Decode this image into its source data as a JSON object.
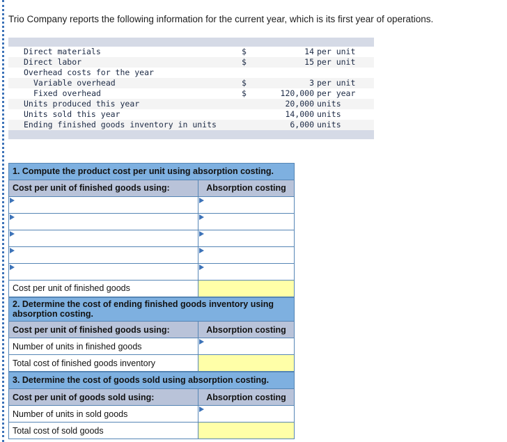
{
  "intro": {
    "text": "Trio Company reports the following information for the current year, which is its first year of operations."
  },
  "facts_table": {
    "rows": [
      {
        "label": "Direct materials",
        "currency": "$",
        "amount": "14",
        "unit": "per unit"
      },
      {
        "label": "Direct labor",
        "currency": "$",
        "amount": "15",
        "unit": "per unit"
      },
      {
        "label": "Overhead costs for the year",
        "currency": "",
        "amount": "",
        "unit": ""
      },
      {
        "label": "Variable overhead",
        "currency": "$",
        "amount": "3",
        "unit": "per unit"
      },
      {
        "label": "Fixed overhead",
        "currency": "$",
        "amount": "120,000",
        "unit": "per year"
      },
      {
        "label": "Units produced this year",
        "currency": "",
        "amount": "20,000",
        "unit": "units"
      },
      {
        "label": "Units sold this year",
        "currency": "",
        "amount": "14,000",
        "unit": "units"
      },
      {
        "label": "Ending finished goods inventory in units",
        "currency": "",
        "amount": "6,000",
        "unit": "units"
      }
    ]
  },
  "requirement1": {
    "question": "1. Compute the product cost per unit using absorption costing.",
    "col_label": "Cost per unit of finished goods using:",
    "col_value": "Absorption costing",
    "total_label": "Cost per unit of finished goods",
    "total_value": ""
  },
  "requirement2": {
    "question": "2. Determine the cost of ending finished goods inventory using absorption costing.",
    "col_label": "Cost per unit of finished goods using:",
    "col_value": "Absorption costing",
    "units_label": "Number of units in finished goods",
    "units_value": "",
    "total_label": "Total cost of finished goods inventory",
    "total_value": ""
  },
  "requirement3": {
    "question": "3. Determine the cost of goods sold using absorption costing.",
    "col_label": "Cost per unit of goods sold using:",
    "col_value": "Absorption costing",
    "units_label": "Number of units in sold goods",
    "units_value": "",
    "total_label": "Total cost of sold goods",
    "total_value": ""
  },
  "colors": {
    "question_header": "#7eb0e0",
    "column_header": "#b9c3d9",
    "total_cell": "#ffffa8",
    "table_border": "#5585b5",
    "facts_band": "#d5dae6",
    "rail": "#3d73b8"
  }
}
